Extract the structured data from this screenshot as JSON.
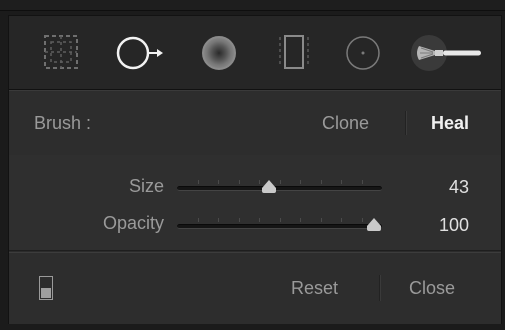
{
  "tools": [
    {
      "name": "crop-overlay-icon"
    },
    {
      "name": "spot-removal-icon"
    },
    {
      "name": "red-eye-correction-icon"
    },
    {
      "name": "graduated-filter-icon"
    },
    {
      "name": "radial-filter-icon"
    },
    {
      "name": "adjustment-brush-icon"
    }
  ],
  "brush": {
    "label": "Brush :",
    "options": [
      "Clone",
      "Heal"
    ],
    "selected": "Heal"
  },
  "sliders": {
    "size": {
      "label": "Size",
      "value": "43",
      "fraction": 0.45
    },
    "opacity": {
      "label": "Opacity",
      "value": "100",
      "fraction": 0.96
    }
  },
  "footer": {
    "reset_label": "Reset",
    "close_label": "Close"
  },
  "colors": {
    "label": "#9a9a9a",
    "selected": "#f0f0f0",
    "value": "#e0e0e0"
  }
}
